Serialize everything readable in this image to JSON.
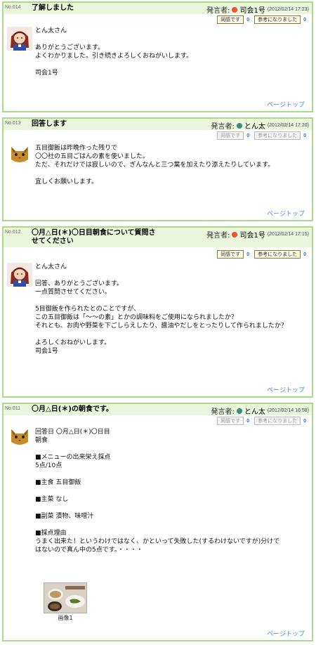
{
  "labels": {
    "poster_label": "発言者:",
    "agree_button": "同感です",
    "helpful_button": "参考になりました",
    "page_top": "ページトップ"
  },
  "posts": [
    {
      "number": "No.014",
      "title": "了解しました",
      "poster": "司会1号",
      "poster_dot_color": "#e8552a",
      "date": "(2012/02/14  17:23)",
      "agree_count": "0",
      "helpful_count": "0",
      "buttons_enabled": true,
      "avatar": "girl-avatar",
      "body": "とん太さん\n\nありがとうございます。\nよくわかりました。引き続きよろしくおねがいします。\n\n司会1号"
    },
    {
      "number": "No.013",
      "title": "回答します",
      "poster": "とん太",
      "poster_dot_color": "#3c8a7a",
      "date": "(2012/02/14  17:20)",
      "agree_count": "0",
      "helpful_count": "0",
      "buttons_enabled": false,
      "avatar": "cat-avatar",
      "body": "五目御飯は昨晩作った残りで\n〇〇社の五目ごはんの素を使いました。\nただ、それだけでは寂しいので、ぎんなんと三つ葉を加えたり添えたりしています。\n\n宜しくお願いします。"
    },
    {
      "number": "No.012",
      "title_line1": "〇月△日(＊)〇日目朝食について質問さ",
      "title_line2": "せてください",
      "poster": "司会1号",
      "poster_dot_color": "#e8552a",
      "date": "(2012/02/14  17:15)",
      "agree_count": "0",
      "helpful_count": "0",
      "buttons_enabled": true,
      "avatar": "girl-avatar",
      "body": "とん太さん\n\n回答、ありがとうございます。\n一点質問させてください。\n\n5目御飯を作られたとのことですが、\nこの五目御飯は「〜〜の素」とかの調味料をご使用になられましたか？\nそれとも、お肉や野菜を下ごしらえしたり、醤油やだしをとったりして作られましたか？\n\nよろしくおねがいします。\n司会1号"
    },
    {
      "number": "No.011",
      "title": "〇月△日(＊)の朝食です。",
      "poster": "とん太",
      "poster_dot_color": "#3c8a7a",
      "date": "(2012/02/14  16:58)",
      "agree_count": "0",
      "helpful_count": "0",
      "buttons_enabled": false,
      "avatar": "cat-avatar",
      "body": "回答日  〇月△日(＊)〇日目\n朝食\n\n■メニューの出来栄え採点\n5点/10点\n\n■主食  五目御飯\n\n■主菜  なし\n\n■副菜  漬物、味噌汁\n\n■採点理由\nうまく出来た！というわけではなく、かといって失敗した(するわけないですが)分けで\nはないので真ん中の5点です。・・・・",
      "image_caption": "画像1"
    }
  ]
}
